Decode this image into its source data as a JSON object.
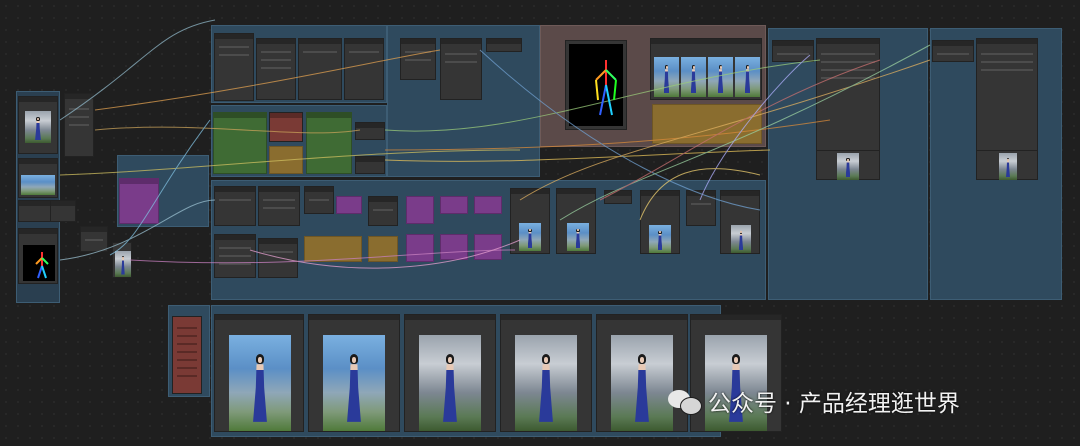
{
  "watermark": {
    "icon": "wechat-icon",
    "text": "公众号 · 产品经理逛世界"
  },
  "colors": {
    "canvas_bg": "#1f1f1f",
    "group_blue": "#2f4a5e",
    "group_brown": "#5b4a49",
    "node_green": "#3f6b34",
    "node_olive": "#8a6d2f",
    "node_purple": "#7a3c8a",
    "node_red": "#7a3a35",
    "dress_blue": "#2a3a9a"
  },
  "output_gallery": {
    "frame_count": 6
  }
}
